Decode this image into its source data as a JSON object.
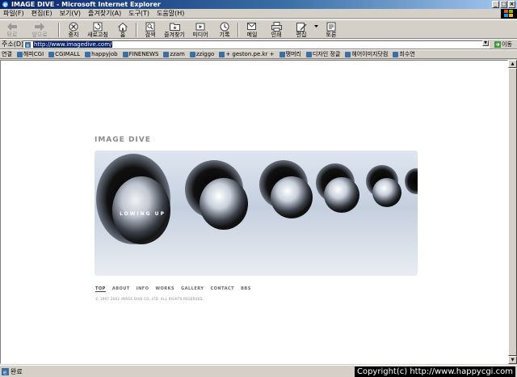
{
  "window": {
    "title": "IMAGE DIVE - Microsoft Internet Explorer"
  },
  "menu": [
    "파일(F)",
    "편집(E)",
    "보기(V)",
    "즐겨찾기(A)",
    "도구(T)",
    "도움말(H)"
  ],
  "toolbar": {
    "back": "뒤로",
    "forward": "앞으로",
    "stop": "중지",
    "refresh": "새로고침",
    "home": "홈",
    "search": "검색",
    "favorites": "즐겨찾기",
    "media": "미디어",
    "history": "기록",
    "mail": "메일",
    "print": "인쇄",
    "edit": "편집",
    "discuss": "토론"
  },
  "address": {
    "label": "주소(D)",
    "url": "http://www.imagedive.com/",
    "go": "이동"
  },
  "links": {
    "label": "연결",
    "items": [
      "해피CGI",
      "CGIMALL",
      "happyjob",
      "FINENEWS",
      "zzam",
      "zziggo",
      "+ geston.pe.kr +",
      "땡머리",
      "디자인 정글",
      "헤어이미지닷컴",
      "최수연"
    ]
  },
  "page": {
    "site_title": "IMAGE DIVE",
    "hero_caption": "LOWING UP",
    "nav": [
      "TOP",
      "ABOUT",
      "INFO",
      "WORKS",
      "GALLERY",
      "CONTACT",
      "BBS"
    ],
    "copyright": "© 1997-2002 IMAGE DIVE CO.,LTD. ALL RIGHTS RESERVED."
  },
  "status": {
    "text": "완료"
  },
  "watermark": "Copyright(c) http://www.happycgi.com"
}
